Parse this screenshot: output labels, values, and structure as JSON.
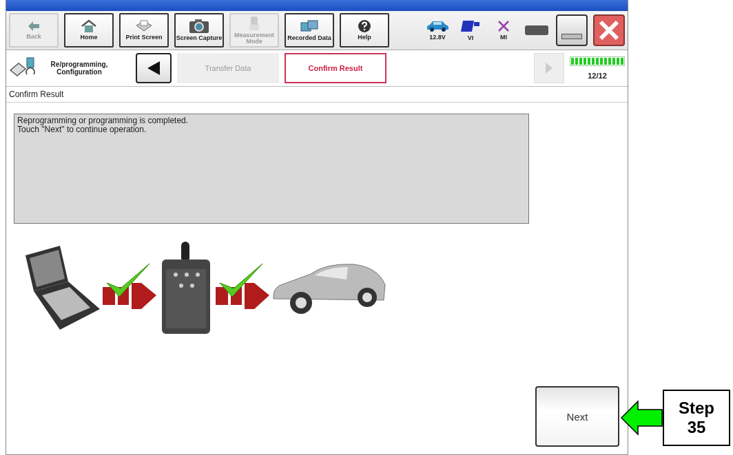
{
  "toolbar": {
    "buttons": [
      {
        "label": "Back",
        "kind": "back",
        "disabled": true
      },
      {
        "label": "Home",
        "kind": "home",
        "disabled": false
      },
      {
        "label": "Print Screen",
        "kind": "printer",
        "disabled": false
      },
      {
        "label": "Screen Capture",
        "kind": "camera",
        "disabled": false
      },
      {
        "label": "Measurement Mode",
        "kind": "meter",
        "disabled": true
      },
      {
        "label": "Recorded Data",
        "kind": "data",
        "disabled": false
      },
      {
        "label": "Help",
        "kind": "help",
        "disabled": false
      }
    ],
    "status": [
      {
        "label": "12.8V",
        "kind": "car"
      },
      {
        "label": "VI",
        "kind": "vi"
      },
      {
        "label": "MI",
        "kind": "mi"
      }
    ]
  },
  "breadcrumb": {
    "section": "Re/programming, Configuration",
    "steps": [
      {
        "label": "Transfer Data",
        "selected": false
      },
      {
        "label": "Confirm Result",
        "selected": true
      }
    ],
    "progress": {
      "level": 1,
      "text": "12/12"
    }
  },
  "page": {
    "heading": "Confirm Result",
    "message": [
      "Reprogramming or programming is completed.",
      "Touch \"Next\" to continue operation."
    ],
    "next_button": "Next"
  },
  "callout": {
    "text": "Step 35"
  }
}
